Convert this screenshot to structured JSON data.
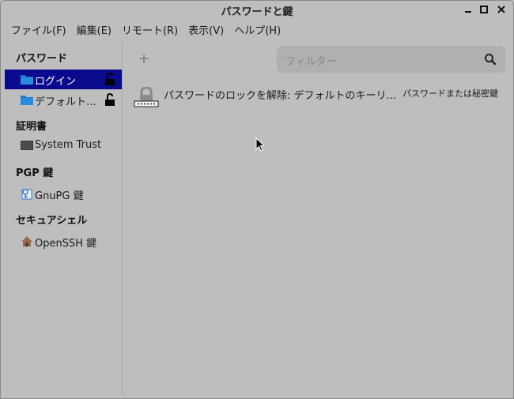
{
  "window": {
    "title": "パスワードと鍵"
  },
  "menubar": [
    "ファイル(F)",
    "編集(E)",
    "リモート(R)",
    "表示(V)",
    "ヘルプ(H)"
  ],
  "sidebar": {
    "sections": [
      {
        "title": "パスワード",
        "items": [
          {
            "label": "ログイン",
            "icon": "folder-icon",
            "lock": "unlocked-icon",
            "selected": true
          },
          {
            "label": "デフォルト…",
            "icon": "folder-icon",
            "lock": "unlocked-icon",
            "selected": false
          }
        ]
      },
      {
        "title": "証明書",
        "items": [
          {
            "label": "System Trust",
            "icon": "monitor-icon"
          }
        ]
      },
      {
        "title": "PGP 鍵",
        "items": [
          {
            "label": "GnuPG 鍵",
            "icon": "key-sheet-icon"
          }
        ]
      },
      {
        "title": "セキュアシェル",
        "items": [
          {
            "label": "OpenSSH 鍵",
            "icon": "home-icon"
          }
        ]
      }
    ]
  },
  "main": {
    "add_label": "+",
    "search": {
      "placeholder": "フィルター"
    },
    "entries": [
      {
        "title": "パスワードのロックを解除: デフォルトのキーリ...",
        "type": "パスワードまたは秘密鍵",
        "icon": "password-lock-icon"
      }
    ]
  },
  "colors": {
    "selection": "#0a0a8e",
    "background": "#bebebe",
    "folder": "#1b78c8"
  }
}
